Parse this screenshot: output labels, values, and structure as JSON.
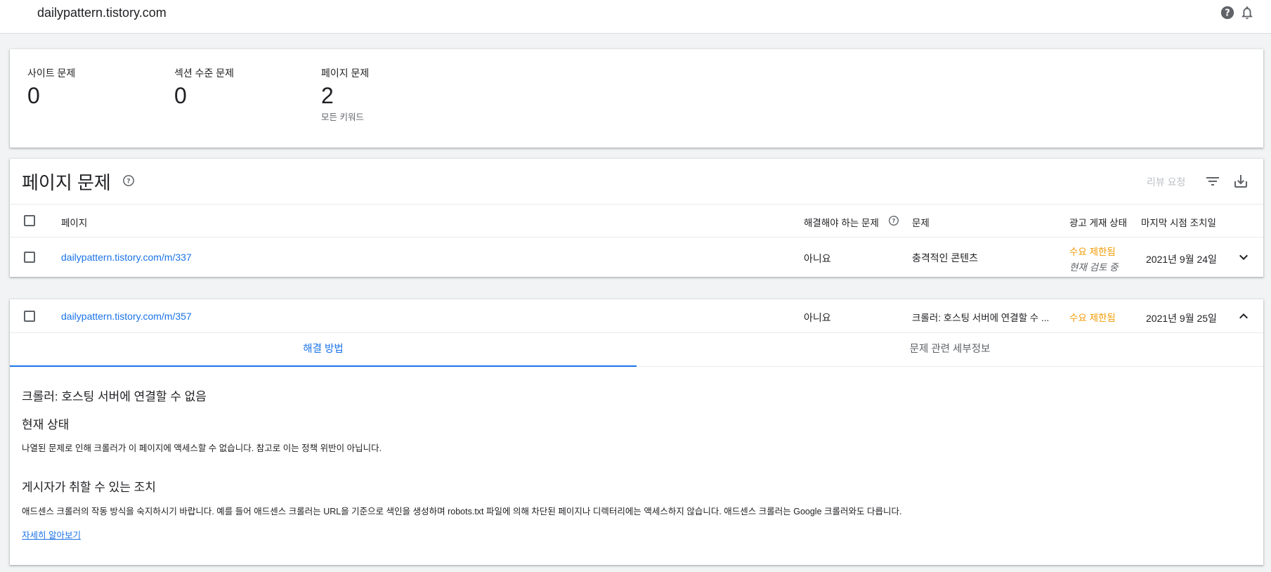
{
  "topbar": {
    "site": "dailypattern.tistory.com",
    "help_icon": "help-circle-icon",
    "bell_icon": "bell-icon"
  },
  "summary": {
    "site_issues": {
      "label": "사이트 문제",
      "value": "0"
    },
    "section_issues": {
      "label": "섹션 수준 문제",
      "value": "0"
    },
    "page_issues": {
      "label": "페이지 문제",
      "value": "2",
      "sub": "모든 키워드"
    }
  },
  "issues": {
    "title": "페이지 문제",
    "review_label": "리뷰 요청",
    "columns": {
      "page": "페이지",
      "must_fix": "해결해야 하는 문제",
      "issue": "문제",
      "ad_status": "광고 게재 상태",
      "last_seen": "마지막 시점 조치일"
    },
    "rows": [
      {
        "page": "dailypattern.tistory.com/m/337",
        "must_fix": "아니요",
        "issue": "충격적인 콘텐츠",
        "ad_status": "수요 제한됨",
        "ad_status_sub": "현재 검토 중",
        "last_seen": "2021년 9월 24일"
      },
      {
        "page": "dailypattern.tistory.com/m/357",
        "must_fix": "아니요",
        "issue": "크롤러: 호스팅 서버에 연결할 수 ...",
        "ad_status": "수요 제한됨",
        "last_seen": "2021년 9월 25일"
      }
    ]
  },
  "detail": {
    "tabs": [
      "해결 방법",
      "문제 관련 세부정보"
    ],
    "heading": "크롤러: 호스팅 서버에 연결할 수 없음",
    "status_title": "현재 상태",
    "status_text": "나열된 문제로 인해 크롤러가 이 페이지에 액세스할 수 없습니다. 참고로 이는 정책 위반이 아닙니다.",
    "action_title": "게시자가 취할 수 있는 조치",
    "action_text": "애드센스 크롤러의 작동 방식을 숙지하시기 바랍니다. 예를 들어 애드센스 크롤러는 URL을 기준으로 색인을 생성하며 robots.txt 파일에 의해 차단된 페이지나 디렉터리에는 액세스하지 않습니다. 애드센스 크롤러는 Google 크롤러와도 다릅니다.",
    "learn_more": "자세히 알아보기"
  },
  "colors": {
    "accent": "#1a73e8",
    "warning": "#f29900"
  }
}
